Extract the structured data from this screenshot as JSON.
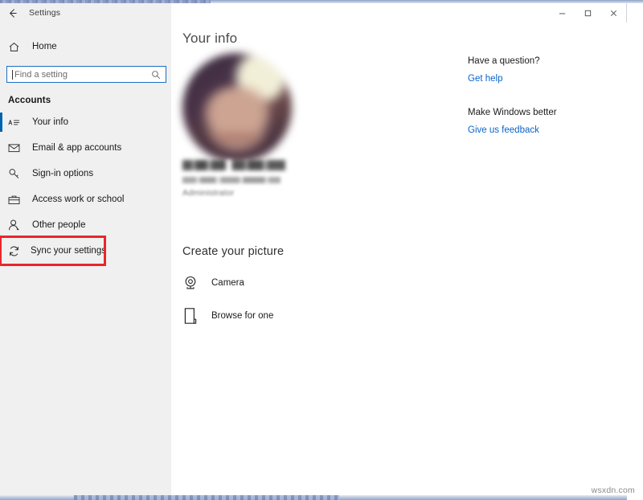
{
  "window": {
    "title": "Settings",
    "back_icon": "back-arrow-icon",
    "minimize_label": "Minimize",
    "maximize_label": "Maximize",
    "close_label": "Close"
  },
  "sidebar": {
    "home": {
      "label": "Home",
      "icon": "home-icon"
    },
    "search": {
      "value": "",
      "placeholder": "Find a setting",
      "icon": "search-icon"
    },
    "group_header": "Accounts",
    "items": [
      {
        "label": "Your info",
        "icon": "your-info-icon",
        "selected": true,
        "highlighted": false
      },
      {
        "label": "Email & app accounts",
        "icon": "mail-icon",
        "selected": false,
        "highlighted": false
      },
      {
        "label": "Sign-in options",
        "icon": "key-icon",
        "selected": false,
        "highlighted": false
      },
      {
        "label": "Access work or school",
        "icon": "briefcase-icon",
        "selected": false,
        "highlighted": false
      },
      {
        "label": "Other people",
        "icon": "person-icon",
        "selected": false,
        "highlighted": false
      },
      {
        "label": "Sync your settings",
        "icon": "sync-icon",
        "selected": false,
        "highlighted": true
      }
    ]
  },
  "main": {
    "page_title": "Your info",
    "account": {
      "avatar_alt": "user profile picture",
      "display_name_redacted": true,
      "email_redacted": true,
      "role": "Administrator"
    },
    "create_picture": {
      "section_title": "Create your picture",
      "options": [
        {
          "label": "Camera",
          "icon": "camera-icon"
        },
        {
          "label": "Browse for one",
          "icon": "browse-file-icon"
        }
      ]
    }
  },
  "help_panel": {
    "question_heading": "Have a question?",
    "question_link": "Get help",
    "feedback_heading": "Make Windows better",
    "feedback_link": "Give us feedback"
  },
  "watermark": "wsxdn.com",
  "colors": {
    "accent_blue": "#0063b1",
    "link_blue": "#0a63c9",
    "highlight_red": "#e8262d",
    "sidebar_bg": "#f0f0f0",
    "content_bg": "#ffffff"
  }
}
